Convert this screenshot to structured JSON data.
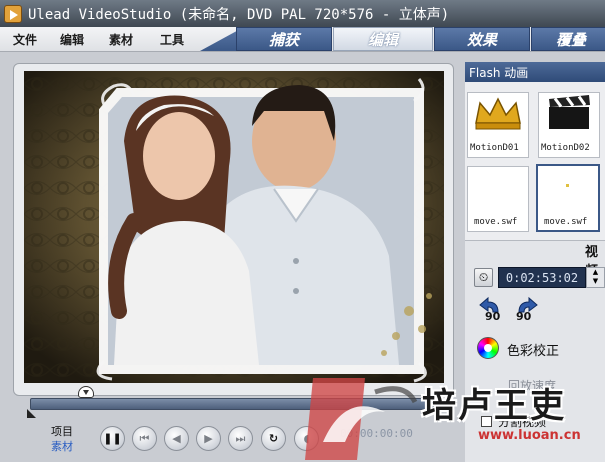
{
  "window": {
    "title": "Ulead VideoStudio (未命名, DVD PAL 720*576 - 立体声)"
  },
  "menu": {
    "items": [
      {
        "label": "文件"
      },
      {
        "label": "编辑"
      },
      {
        "label": "素材"
      },
      {
        "label": "工具"
      }
    ]
  },
  "steps": {
    "items": [
      {
        "label": "捕获",
        "active": false
      },
      {
        "label": "编辑",
        "active": true
      },
      {
        "label": "效果",
        "active": false
      },
      {
        "label": "覆叠",
        "active": false
      }
    ]
  },
  "library": {
    "header": "Flash 动画",
    "items": [
      {
        "label": "MotionD01",
        "icon": "crown-icon"
      },
      {
        "label": "MotionD02",
        "icon": "clapperboard-icon"
      },
      {
        "label": "move.swf",
        "icon": "blank-flash-icon"
      },
      {
        "label": "move.swf",
        "icon": "sparkle-flash-icon",
        "selected": true
      }
    ]
  },
  "options": {
    "tab_label": "视频",
    "duration": "0:02:53:02",
    "rotate_left_value": "90",
    "rotate_right_value": "90",
    "color_correction": "色彩校正",
    "playback_speed": "回放速度",
    "split_video": "分割视频"
  },
  "player": {
    "mode_project": "项目",
    "mode_clip": "素材",
    "timecode": "00:00:00:00"
  },
  "watermark": {
    "text": "培卢王吏",
    "url": "www.luoan.cn"
  },
  "colors": {
    "accent": "#3b5887",
    "titlebar": "#3f4852",
    "duration_bg": "#21324f"
  }
}
